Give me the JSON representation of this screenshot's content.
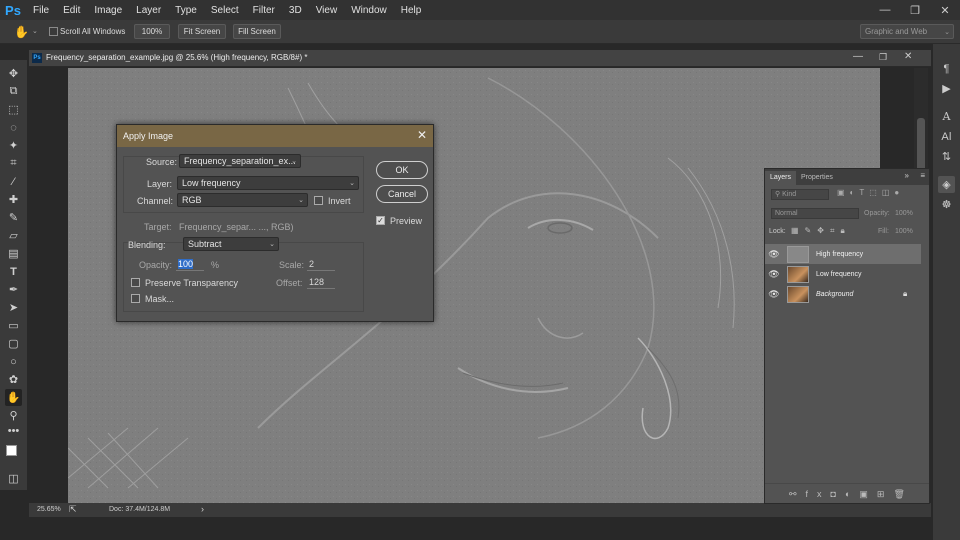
{
  "app": {
    "logo": "Ps"
  },
  "menu": [
    "File",
    "Edit",
    "Image",
    "Layer",
    "Type",
    "Select",
    "Filter",
    "3D",
    "View",
    "Window",
    "Help"
  ],
  "window_controls": {
    "minimize": "—",
    "restore": "❐",
    "close": "✕"
  },
  "options": {
    "scroll_all": "Scroll All Windows",
    "zoom_100": "100%",
    "fit_screen": "Fit Screen",
    "fill_screen": "Fill Screen",
    "workspace": "Graphic and Web"
  },
  "document": {
    "tab_title": "Frequency_separation_example.jpg @ 25.6% (High frequency, RGB/8#) *",
    "zoom": "25.65%",
    "doc_size": "Doc: 37.4M/124.8M"
  },
  "layers_panel": {
    "tabs": [
      "Layers",
      "Properties"
    ],
    "filter_kind": "Kind",
    "blend_mode": "Normal",
    "opacity_label": "Opacity:",
    "opacity_value": "100%",
    "lock_label": "Lock:",
    "fill_label": "Fill:",
    "fill_value": "100%",
    "layers": [
      {
        "name": "High frequency",
        "selected": true
      },
      {
        "name": "Low frequency",
        "selected": false
      },
      {
        "name": "Background",
        "selected": false,
        "locked": true
      }
    ]
  },
  "dialog": {
    "title": "Apply Image",
    "source_label": "Source:",
    "source_value": "Frequency_separation_ex...",
    "layer_label": "Layer:",
    "layer_value": "Low frequency",
    "channel_label": "Channel:",
    "channel_value": "RGB",
    "invert_label": "Invert",
    "target_label": "Target:",
    "target_value": "Frequency_separ... ..., RGB)",
    "blending_label": "Blending:",
    "blending_value": "Subtract",
    "opacity_label": "Opacity:",
    "opacity_value": "100",
    "opacity_unit": "%",
    "scale_label": "Scale:",
    "scale_value": "2",
    "offset_label": "Offset:",
    "offset_value": "128",
    "preserve_label": "Preserve Transparency",
    "mask_label": "Mask...",
    "ok": "OK",
    "cancel": "Cancel",
    "preview_label": "Preview",
    "preview_checked": true
  },
  "colors": {
    "accent": "#31a8ff",
    "dialog_title": "#796745",
    "canvas_gray": "#808080"
  }
}
